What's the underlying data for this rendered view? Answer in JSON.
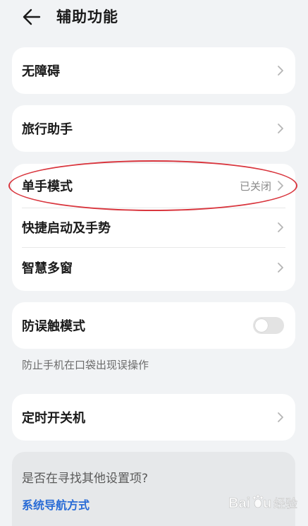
{
  "header": {
    "title": "辅助功能"
  },
  "cards": {
    "accessibility": {
      "label": "无障碍"
    },
    "travel": {
      "label": "旅行助手"
    },
    "group": {
      "one_hand": {
        "label": "单手模式",
        "value": "已关闭"
      },
      "shortcut": {
        "label": "快捷启动及手势"
      },
      "smart_window": {
        "label": "智慧多窗"
      }
    },
    "mistouch": {
      "label": "防误触模式",
      "enabled": false
    },
    "mistouch_hint": "防止手机在口袋出现误操作",
    "timer": {
      "label": "定时开关机"
    }
  },
  "suggest": {
    "question": "是否在寻找其他设置项?",
    "link": "系统导航方式"
  },
  "colors": {
    "background": "#f1f3f5",
    "card": "#ffffff",
    "link": "#2a6cd6",
    "annotation": "#d9363e"
  }
}
